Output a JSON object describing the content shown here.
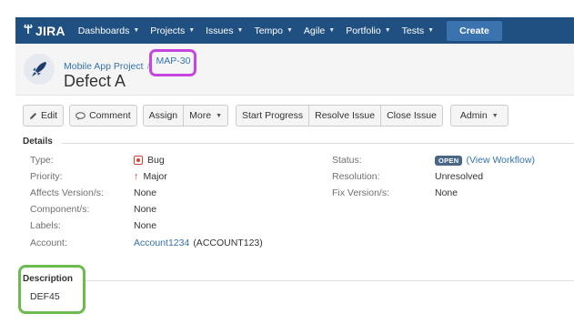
{
  "nav": {
    "logo": "JIRA",
    "items": [
      {
        "label": "Dashboards"
      },
      {
        "label": "Projects"
      },
      {
        "label": "Issues"
      },
      {
        "label": "Tempo"
      },
      {
        "label": "Agile"
      },
      {
        "label": "Portfolio"
      },
      {
        "label": "Tests"
      }
    ],
    "create_label": "Create",
    "bar_color": "#205081"
  },
  "issue": {
    "project": "Mobile App Project",
    "separator": "/",
    "key": "MAP-30",
    "summary": "Defect A"
  },
  "toolbar": {
    "edit": "Edit",
    "comment": "Comment",
    "assign": "Assign",
    "more": "More",
    "start_progress": "Start Progress",
    "resolve_issue": "Resolve Issue",
    "close_issue": "Close Issue",
    "admin": "Admin"
  },
  "details": {
    "heading": "Details",
    "type_label": "Type:",
    "type_value": "Bug",
    "priority_label": "Priority:",
    "priority_value": "Major",
    "affects_label": "Affects Version/s:",
    "affects_value": "None",
    "components_label": "Component/s:",
    "components_value": "None",
    "labels_label": "Labels:",
    "labels_value": "None",
    "account_label": "Account:",
    "account_link": "Account1234",
    "account_code": "(ACCOUNT123)",
    "status_label": "Status:",
    "status_value": "OPEN",
    "view_workflow_open": "(",
    "view_workflow": "View Workflow",
    "view_workflow_close": ")",
    "resolution_label": "Resolution:",
    "resolution_value": "Unresolved",
    "fix_label": "Fix Version/s:",
    "fix_value": "None"
  },
  "description": {
    "heading": "Description",
    "text": "DEF45"
  },
  "highlights": {
    "issue_key_color": "#c644e0",
    "description_color": "#6cbb4f"
  }
}
